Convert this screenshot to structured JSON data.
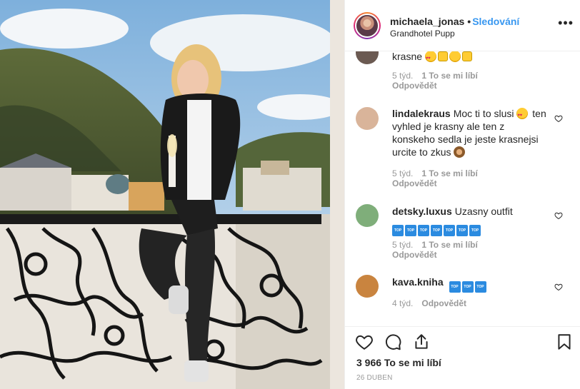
{
  "post": {
    "username": "michaela_jonas",
    "separator": "•",
    "follow_label": "Sledování",
    "location": "Grandhotel Pupp",
    "more_icon": "ellipsis-icon"
  },
  "comments": [
    {
      "user": "",
      "text": "krasne",
      "emojis": [
        "heart-eyes",
        "raising-hands",
        "grin",
        "raising-hands"
      ],
      "age": "5 týd.",
      "likes": "1 To se mi líbí",
      "reply": "Odpovědět",
      "avatar_color": "#6b5a52"
    },
    {
      "user": "lindalekraus",
      "text_before": "Moc ti to slusi",
      "text_after": "ten vyhled je krasny ale ten z konskeho sedla je jeste krasnejsi urcite to zkus",
      "age": "5 týd.",
      "likes": "1 To se mi líbí",
      "reply": "Odpovědět",
      "avatar_color": "#d9b49a"
    },
    {
      "user": "detsky.luxus",
      "text": "Uzasny outfit",
      "badge_text": "TOP",
      "badge_count": 7,
      "age": "5 týd.",
      "likes": "1 To se mi líbí",
      "reply": "Odpovědět",
      "avatar_color": "#7fae7a"
    },
    {
      "user": "kava.kniha",
      "text": "",
      "badge_text": "TOP",
      "badge_count": 3,
      "age": "4 týd.",
      "reply": "Odpovědět",
      "avatar_color": "#c9843f"
    }
  ],
  "actions": {
    "like_icon": "heart-icon",
    "comment_icon": "comment-icon",
    "share_icon": "share-icon",
    "save_icon": "bookmark-icon",
    "likes_total": "3 966 To se mi líbí",
    "date": "26 DUBEN"
  },
  "colors": {
    "accent": "#3897f0",
    "muted": "#999999",
    "text": "#262626"
  }
}
